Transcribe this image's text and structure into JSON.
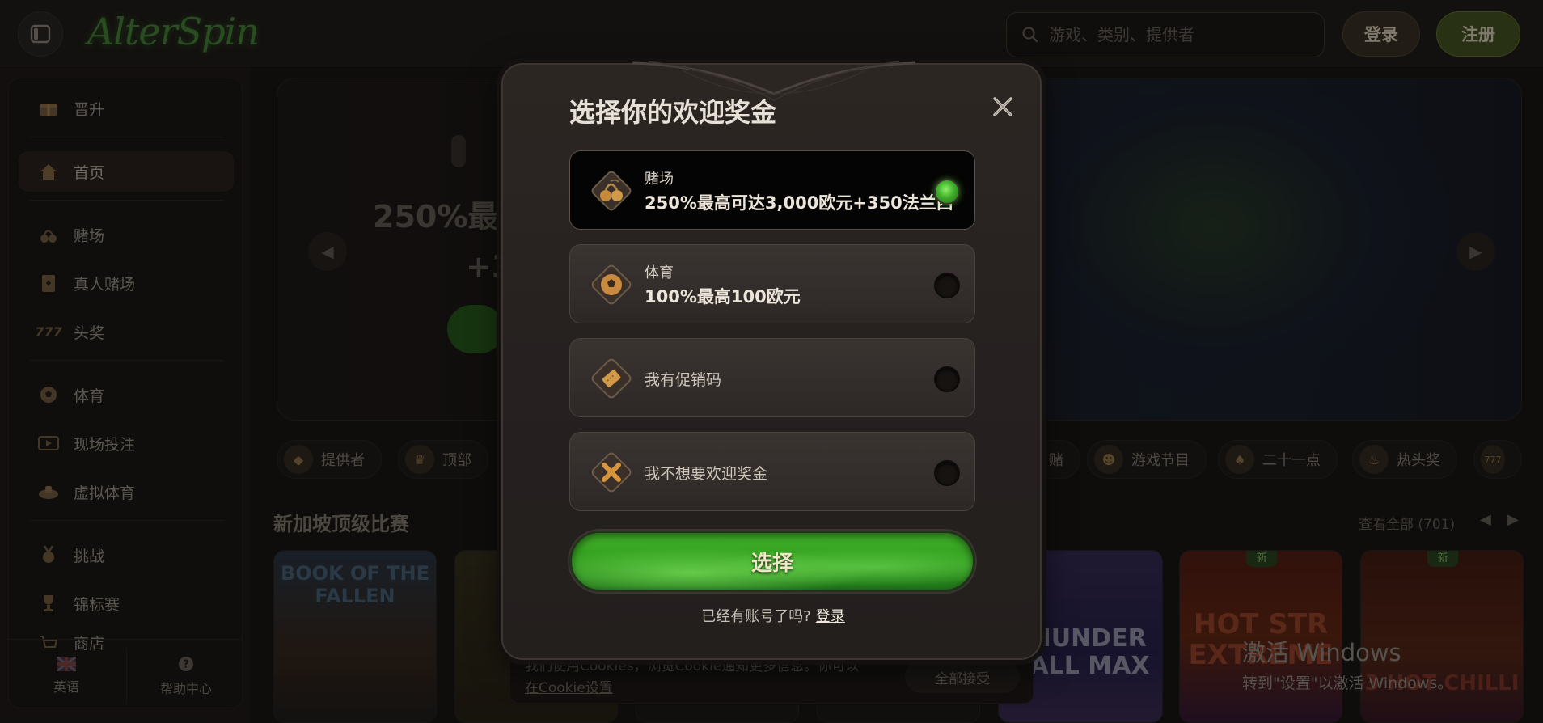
{
  "header": {
    "logo_text": "AlterSpin",
    "search_placeholder": "游戏、类别、提供者",
    "login_label": "登录",
    "register_label": "注册"
  },
  "sidebar": {
    "items": [
      {
        "label": "晋升",
        "icon": "gift-icon"
      },
      {
        "label": "首页",
        "icon": "home-icon"
      },
      {
        "label": "赌场",
        "icon": "cherries-icon"
      },
      {
        "label": "真人赌场",
        "icon": "playing-card-icon"
      },
      {
        "label": "头奖",
        "icon": "triple-seven-icon"
      },
      {
        "label": "体育",
        "icon": "soccer-ball-icon"
      },
      {
        "label": "现场投注",
        "icon": "live-play-icon"
      },
      {
        "label": "虚拟体育",
        "icon": "virtual-sports-icon"
      },
      {
        "label": "挑战",
        "icon": "medal-icon"
      },
      {
        "label": "锦标赛",
        "icon": "trophy-icon"
      },
      {
        "label": "商店",
        "icon": "cart-icon"
      }
    ],
    "footer": {
      "language_label": "英语",
      "help_label": "帮助中心"
    }
  },
  "hero": {
    "line1": "250%最高",
    "line2": "+3"
  },
  "chips": [
    "提供者",
    "顶部",
    "赌",
    "游戏节目",
    "二十一点",
    "热头奖"
  ],
  "section": {
    "title": "新加坡顶级比赛",
    "view_all": "查看全部 (701)"
  },
  "games": [
    {
      "title": "BOOK OF THE FALLEN",
      "badge": ""
    },
    {
      "title": "",
      "badge": ""
    },
    {
      "title": "",
      "badge": ""
    },
    {
      "title": "",
      "badge": ""
    },
    {
      "title": "THUNDER BALL MAX",
      "badge": ""
    },
    {
      "title": "HOT STR EXTREME",
      "badge": "新"
    },
    {
      "title": "3 HOT CHILLI",
      "badge": "新"
    }
  ],
  "cookie": {
    "text_line1": "我们使用Cookies，浏览Cookie通知更多信息。你可以",
    "text_line2": "在Cookie设置",
    "accept_label": "全部接受"
  },
  "modal": {
    "title": "选择你的欢迎奖金",
    "options": [
      {
        "label": "赌场",
        "value": "250%最高可达3,000欧元+350法兰西",
        "selected": true,
        "icon": "cherries-icon"
      },
      {
        "label": "体育",
        "value": "100%最高100欧元",
        "selected": false,
        "icon": "soccer-ball-icon"
      },
      {
        "label": "我有促销码",
        "selected": false,
        "icon": "ticket-icon"
      },
      {
        "label": "我不想要欢迎奖金",
        "selected": false,
        "icon": "x-mark-icon"
      }
    ],
    "select_label": "选择",
    "have_account_text": "已经有账号了吗?",
    "login_link": "登录"
  },
  "windows_watermark": {
    "line1": "激活 Windows",
    "line2": "转到\"设置\"以激活 Windows。"
  },
  "colors": {
    "accent_green": "#3fae2a",
    "background": "#1c1917",
    "modal_bg": "#2c2623"
  }
}
